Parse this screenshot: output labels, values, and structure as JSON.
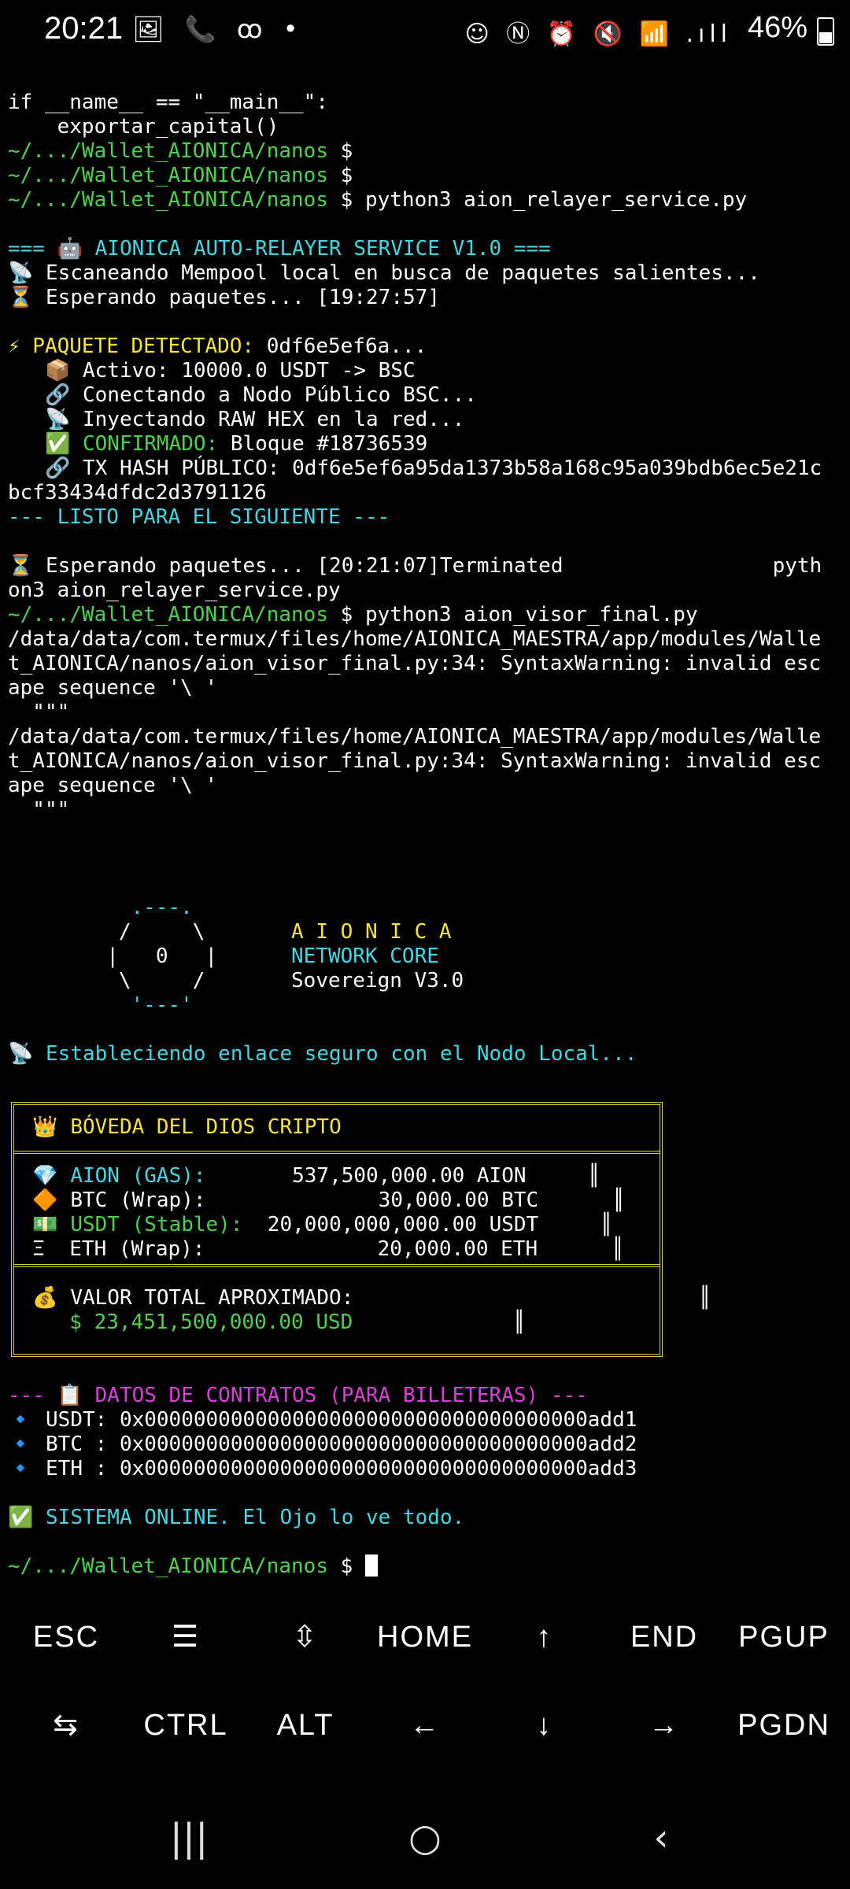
{
  "status_bar": {
    "time": "20:21",
    "left_icons": "🖼 📞 ꝏ •",
    "right_icons": "☺ Ⓝ ⏰ 🔇 📶 .ıll",
    "battery": "46%"
  },
  "terminal": {
    "lines": [
      {
        "segments": [
          {
            "t": "if __name__ == \"__main__\":",
            "c": "w"
          }
        ]
      },
      {
        "segments": [
          {
            "t": "    exportar_capital()",
            "c": "w"
          }
        ]
      },
      {
        "segments": [
          {
            "t": "~/.../Wallet_AIONICA/nanos",
            "c": "g"
          },
          {
            "t": " $",
            "c": "w"
          }
        ]
      },
      {
        "segments": [
          {
            "t": "~/.../Wallet_AIONICA/nanos",
            "c": "g"
          },
          {
            "t": " $",
            "c": "w"
          }
        ]
      },
      {
        "segments": [
          {
            "t": "~/.../Wallet_AIONICA/nanos",
            "c": "g"
          },
          {
            "t": " $ python3 aion_relayer_service.py",
            "c": "w"
          }
        ]
      },
      {
        "segments": [
          {
            "t": "",
            "c": "w"
          }
        ]
      },
      {
        "segments": [
          {
            "t": "=== 🤖 AIONICA AUTO-RELAYER SERVICE V1.0 ===",
            "c": "c"
          }
        ]
      },
      {
        "segments": [
          {
            "t": "📡 Escaneando Mempool local en busca de paquetes salientes...",
            "c": "w"
          }
        ]
      },
      {
        "segments": [
          {
            "t": "⏳ Esperando paquetes... [19:27:57]",
            "c": "w"
          }
        ]
      },
      {
        "segments": [
          {
            "t": "",
            "c": "w"
          }
        ]
      },
      {
        "segments": [
          {
            "t": "⚡ PAQUETE DETECTADO:",
            "c": "y"
          },
          {
            "t": " 0df6e5ef6a...",
            "c": "w"
          }
        ]
      },
      {
        "segments": [
          {
            "t": "   📦 Activo: 10000.0 USDT -> BSC",
            "c": "w"
          }
        ]
      },
      {
        "segments": [
          {
            "t": "   🔗 Conectando a Nodo Público BSC...",
            "c": "w"
          }
        ]
      },
      {
        "segments": [
          {
            "t": "   📡 Inyectando RAW HEX en la red...",
            "c": "w"
          }
        ]
      },
      {
        "segments": [
          {
            "t": "   ✅ ",
            "c": "w"
          },
          {
            "t": "CONFIRMADO:",
            "c": "g"
          },
          {
            "t": " Bloque #18736539",
            "c": "w"
          }
        ]
      },
      {
        "segments": [
          {
            "t": "   🔗 TX HASH PÚBLICO: 0df6e5ef6a95da1373b58a168c95a039bdb6ec5e21c",
            "c": "w"
          }
        ]
      },
      {
        "segments": [
          {
            "t": "bcf33434dfdc2d3791126",
            "c": "w"
          }
        ]
      },
      {
        "segments": [
          {
            "t": "--- LISTO PARA EL SIGUIENTE ---",
            "c": "c"
          }
        ]
      },
      {
        "segments": [
          {
            "t": "",
            "c": "w"
          }
        ]
      },
      {
        "segments": [
          {
            "t": "⏳ Esperando paquetes... [20:21:07]Terminated                 pyth",
            "c": "w"
          }
        ]
      },
      {
        "segments": [
          {
            "t": "on3 aion_relayer_service.py",
            "c": "w"
          }
        ]
      },
      {
        "segments": [
          {
            "t": "~/.../Wallet_AIONICA/nanos",
            "c": "g"
          },
          {
            "t": " $ python3 aion_visor_final.py",
            "c": "w"
          }
        ]
      },
      {
        "segments": [
          {
            "t": "/data/data/com.termux/files/home/AIONICA_MAESTRA/app/modules/Walle",
            "c": "w"
          }
        ]
      },
      {
        "segments": [
          {
            "t": "t_AIONICA/nanos/aion_visor_final.py:34: SyntaxWarning: invalid esc",
            "c": "w"
          }
        ]
      },
      {
        "segments": [
          {
            "t": "ape sequence '\\ '",
            "c": "w"
          }
        ]
      },
      {
        "segments": [
          {
            "t": "  \"\"\"",
            "c": "w"
          }
        ]
      },
      {
        "segments": [
          {
            "t": "/data/data/com.termux/files/home/AIONICA_MAESTRA/app/modules/Walle",
            "c": "w"
          }
        ]
      },
      {
        "segments": [
          {
            "t": "t_AIONICA/nanos/aion_visor_final.py:34: SyntaxWarning: invalid esc",
            "c": "w"
          }
        ]
      },
      {
        "segments": [
          {
            "t": "ape sequence '\\ '",
            "c": "w"
          }
        ]
      },
      {
        "segments": [
          {
            "t": "  \"\"\"",
            "c": "w"
          }
        ]
      },
      {
        "segments": [
          {
            "t": "",
            "c": "w"
          }
        ]
      },
      {
        "segments": [
          {
            "t": "",
            "c": "w"
          }
        ]
      },
      {
        "segments": [
          {
            "t": "",
            "c": "w"
          }
        ]
      },
      {
        "segments": [
          {
            "t": "          .---.",
            "c": "c"
          }
        ]
      },
      {
        "segments": [
          {
            "t": "         /     \\       ",
            "c": "w"
          },
          {
            "t": "A I O N I C A",
            "c": "y"
          }
        ]
      },
      {
        "segments": [
          {
            "t": "        |   0   |      ",
            "c": "w"
          },
          {
            "t": "NETWORK CORE",
            "c": "c"
          }
        ]
      },
      {
        "segments": [
          {
            "t": "         \\     /       ",
            "c": "w"
          },
          {
            "t": "Sovereign V3.0",
            "c": "w"
          }
        ]
      },
      {
        "segments": [
          {
            "t": "          '---'",
            "c": "c"
          }
        ]
      },
      {
        "segments": [
          {
            "t": "",
            "c": "w"
          }
        ]
      },
      {
        "segments": [
          {
            "t": "📡 ",
            "c": "w"
          },
          {
            "t": "Estableciendo enlace seguro con el Nodo Local...",
            "c": "c"
          }
        ]
      },
      {
        "segments": [
          {
            "t": "",
            "c": "w"
          }
        ]
      },
      {
        "segments": [
          {
            "t": "",
            "c": "w"
          }
        ]
      },
      {
        "segments": [
          {
            "t": "  👑 ",
            "c": "w"
          },
          {
            "t": "BÓVEDA DEL DIOS CRIPTO",
            "c": "y"
          }
        ]
      },
      {
        "segments": [
          {
            "t": "",
            "c": "w"
          }
        ]
      },
      {
        "segments": [
          {
            "t": "  💎 ",
            "c": "w"
          },
          {
            "t": "AION (GAS):",
            "c": "c"
          },
          {
            "t": "       537,500,000.00 AION     ║",
            "c": "w"
          }
        ]
      },
      {
        "segments": [
          {
            "t": "  🔶 BTC (Wrap):              30,000.00 BTC      ║",
            "c": "w"
          }
        ]
      },
      {
        "segments": [
          {
            "t": "  💵 ",
            "c": "w"
          },
          {
            "t": "USDT (Stable):",
            "c": "g"
          },
          {
            "t": "  20,000,000,000.00 USDT     ║",
            "c": "w"
          }
        ]
      },
      {
        "segments": [
          {
            "t": "  Ξ  ETH (Wrap):              20,000.00 ETH      ║",
            "c": "w"
          }
        ]
      },
      {
        "segments": [
          {
            "t": "",
            "c": "w"
          }
        ]
      },
      {
        "segments": [
          {
            "t": "  💰 VALOR TOTAL APROXIMADO:                            ║",
            "c": "w"
          }
        ]
      },
      {
        "segments": [
          {
            "t": "     ",
            "c": "w"
          },
          {
            "t": "$ 23,451,500,000.00 USD",
            "c": "g"
          },
          {
            "t": "             ║",
            "c": "w"
          }
        ]
      },
      {
        "segments": [
          {
            "t": "",
            "c": "w"
          }
        ]
      },
      {
        "segments": [
          {
            "t": "",
            "c": "w"
          }
        ]
      },
      {
        "segments": [
          {
            "t": "--- 📋 ",
            "c": "m"
          },
          {
            "t": "DATOS DE CONTRATOS (PARA BILLETERAS) ---",
            "c": "m"
          }
        ]
      },
      {
        "segments": [
          {
            "t": "🔹 USDT: 0x000000000000000000000000000000000000add1",
            "c": "w"
          }
        ]
      },
      {
        "segments": [
          {
            "t": "🔹 BTC : 0x000000000000000000000000000000000000add2",
            "c": "w"
          }
        ]
      },
      {
        "segments": [
          {
            "t": "🔹 ETH : 0x000000000000000000000000000000000000add3",
            "c": "w"
          }
        ]
      },
      {
        "segments": [
          {
            "t": "",
            "c": "w"
          }
        ]
      },
      {
        "segments": [
          {
            "t": "✅ ",
            "c": "w"
          },
          {
            "t": "SISTEMA ONLINE. El Ojo lo ve todo.",
            "c": "c"
          }
        ]
      },
      {
        "segments": [
          {
            "t": "",
            "c": "w"
          }
        ]
      },
      {
        "segments": [
          {
            "t": "~/.../Wallet_AIONICA/nanos",
            "c": "g"
          },
          {
            "t": " $ ",
            "c": "w"
          }
        ]
      }
    ]
  },
  "extra_keys": {
    "row1": [
      "ESC",
      "☰",
      "⇳",
      "HOME",
      "↑",
      "END",
      "PGUP"
    ],
    "row2": [
      "⇆",
      "CTRL",
      "ALT",
      "←",
      "↓",
      "→",
      "PGDN"
    ]
  },
  "nav": {
    "recents": "|||",
    "home": "○",
    "back": "‹"
  },
  "colors": {
    "prompt": "#4ad34a",
    "cyan": "#3fd7e6",
    "yellow": "#f5e33a",
    "magenta": "#d93ed9",
    "vault_border": "#d8d030"
  }
}
